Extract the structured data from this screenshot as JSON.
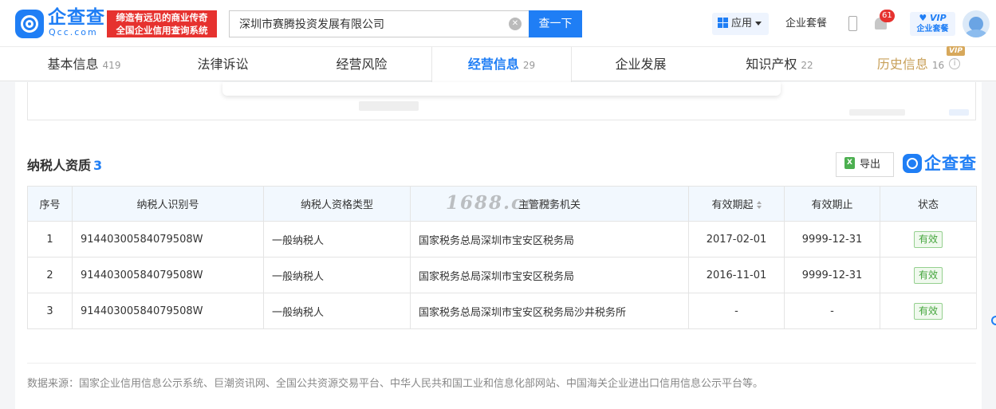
{
  "header": {
    "brand_name": "企查查",
    "brand_domain": "Qcc.com",
    "slogan_line1": "缔造有远见的商业传奇",
    "slogan_line2": "全国企业信用查询系统",
    "search_value": "深圳市赛腾投资发展有限公司",
    "search_button": "查一下",
    "app_label": "应用",
    "package_link": "企业套餐",
    "notification_count": "61",
    "vip_line1": "VIP",
    "vip_line2": "企业套餐"
  },
  "tabs": [
    {
      "label": "基本信息",
      "count": "419"
    },
    {
      "label": "法律诉讼",
      "count": ""
    },
    {
      "label": "经营风险",
      "count": ""
    },
    {
      "label": "经营信息",
      "count": "29"
    },
    {
      "label": "企业发展",
      "count": ""
    },
    {
      "label": "知识产权",
      "count": "22"
    },
    {
      "label": "历史信息",
      "count": "16",
      "badge": "VIP"
    }
  ],
  "section": {
    "title": "纳税人资质",
    "count": "3",
    "export_label": "导出",
    "xls_glyph": "X",
    "logo_text": "企查查"
  },
  "table": {
    "headers": [
      "序号",
      "纳税人识别号",
      "纳税人资格类型",
      "主管税务机关",
      "有效期起",
      "有效期止",
      "状态"
    ],
    "rows": [
      {
        "no": "1",
        "tax_id": "91440300584079508W",
        "type": "一般纳税人",
        "authority": "国家税务总局深圳市宝安区税务局",
        "start": "2017-02-01",
        "end": "9999-12-31",
        "status": "有效"
      },
      {
        "no": "2",
        "tax_id": "91440300584079508W",
        "type": "一般纳税人",
        "authority": "国家税务总局深圳市宝安区税务局",
        "start": "2016-11-01",
        "end": "9999-12-31",
        "status": "有效"
      },
      {
        "no": "3",
        "tax_id": "91440300584079508W",
        "type": "一般纳税人",
        "authority": "国家税务总局深圳市宝安区税务局沙井税务所",
        "start": "-",
        "end": "-",
        "status": "有效"
      }
    ]
  },
  "watermark": "1688.com",
  "source_note": "数据来源：国家企业信用信息公示系统、巨潮资讯网、全国公共资源交易平台、中华人民共和国工业和信息化部网站、中国海关企业进出口信用信息公示平台等。",
  "colors": {
    "brand": "#1f7ef5",
    "slogan_bg": "#e6322f",
    "status_green": "#44a53c",
    "vip_gold": "#c8a059"
  }
}
